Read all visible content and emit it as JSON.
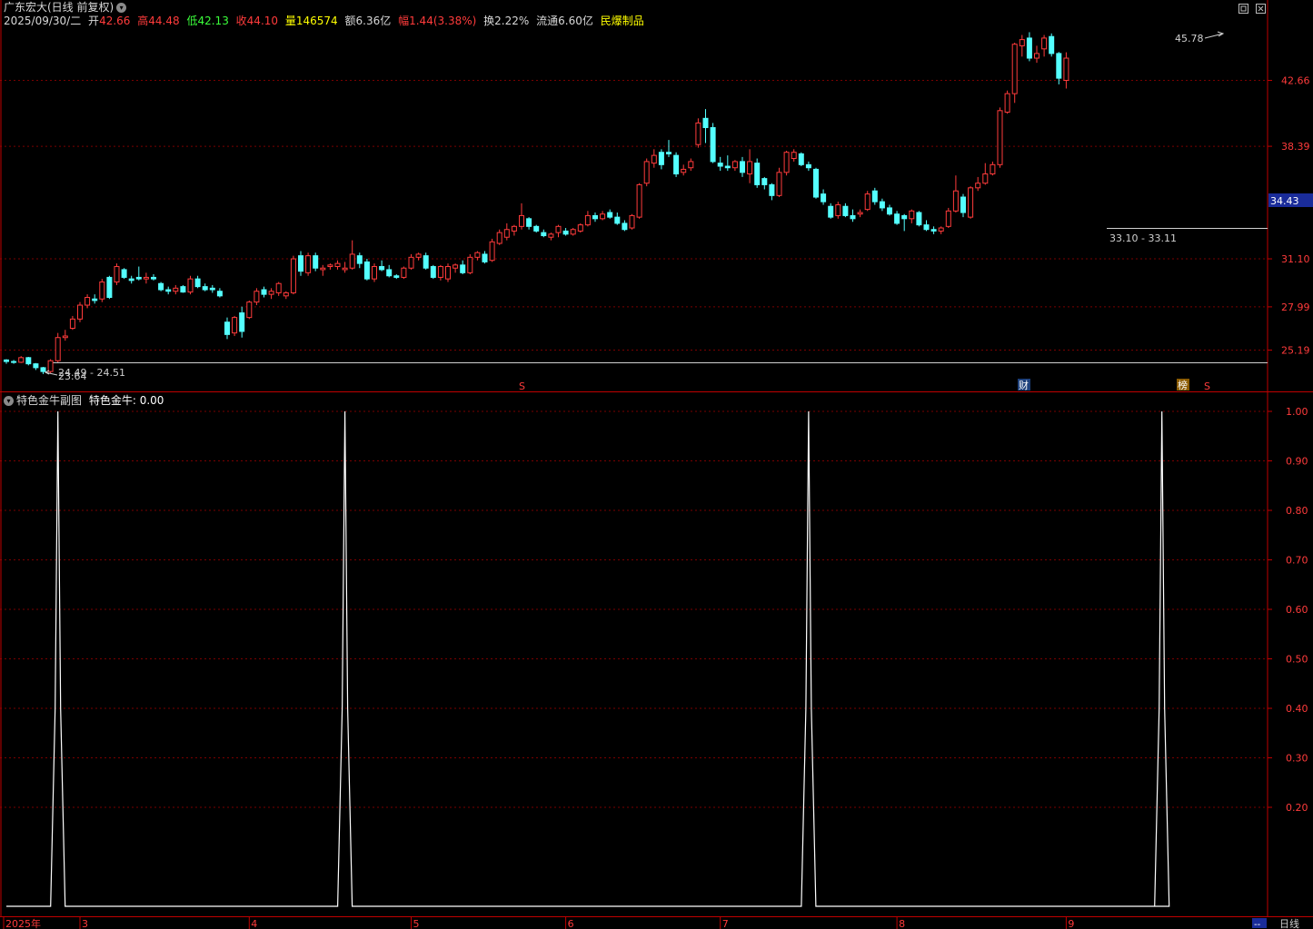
{
  "header": {
    "title": "广东宏大(日线 前复权)",
    "date": "2025/09/30/二",
    "open_label": "开",
    "open": "42.66",
    "high_label": "高",
    "high": "44.48",
    "low_label": "低",
    "low": "42.13",
    "close_label": "收",
    "close": "44.10",
    "vol_label": "量",
    "vol": "146574",
    "amount_label": "额",
    "amount": "6.36亿",
    "change_label": "幅",
    "change": "1.44(3.38%)",
    "turnover_label": "换",
    "turnover": "2.22%",
    "float_label": "流通",
    "float": "6.60亿",
    "sector": "民爆制品"
  },
  "window_controls": {
    "restore_icon": "restore-icon",
    "close_icon": "close-icon"
  },
  "sub_header": {
    "name": "特色金牛副图",
    "value_label": "特色金牛: 0.00"
  },
  "main_axis": {
    "ticks": [
      "42.66",
      "38.39",
      "31.10",
      "27.99",
      "25.19"
    ],
    "current_price": "34.43"
  },
  "sub_axis": {
    "ticks": [
      "1.00",
      "0.90",
      "0.80",
      "0.70",
      "0.60",
      "0.50",
      "0.40",
      "0.30",
      "0.20"
    ]
  },
  "annotations": {
    "high_mark": "45.78",
    "low_mark": "23.64",
    "range_left": "24.49 - 24.51",
    "range_right": "33.10 - 33.11",
    "event_s1": "S",
    "event_cai": "财",
    "event_bang": "榜",
    "event_s2": "S"
  },
  "x_axis": {
    "labels": [
      "2025年",
      "3",
      "4",
      "5",
      "6",
      "7",
      "8",
      "9"
    ]
  },
  "footer": {
    "period": "日线",
    "dash": "--"
  },
  "colors": {
    "up": "#ff3b3b",
    "down": "#54ffff",
    "grid": "#7a0000",
    "axis": "#c00000",
    "yellow": "#ffff00"
  },
  "chart_data": [
    {
      "type": "candlestick",
      "title": "广东宏大(日线 前复权)",
      "ylim": [
        23.0,
        46.5
      ],
      "y_ticks": [
        42.66,
        38.39,
        31.1,
        27.99,
        25.19
      ],
      "x_labels": [
        "2025年",
        "3",
        "4",
        "5",
        "6",
        "7",
        "8",
        "9"
      ],
      "ohlc": [
        [
          24.55,
          24.6,
          24.3,
          24.45
        ],
        [
          24.45,
          24.55,
          24.3,
          24.4
        ],
        [
          24.4,
          24.8,
          24.35,
          24.7
        ],
        [
          24.7,
          24.75,
          24.2,
          24.3
        ],
        [
          24.3,
          24.35,
          23.9,
          24.05
        ],
        [
          24.05,
          24.1,
          23.64,
          23.8
        ],
        [
          23.8,
          24.6,
          23.7,
          24.5
        ],
        [
          24.5,
          26.3,
          24.4,
          26.0
        ],
        [
          26.0,
          26.5,
          25.8,
          26.1
        ],
        [
          26.6,
          27.4,
          26.5,
          27.2
        ],
        [
          27.2,
          28.3,
          27.0,
          28.1
        ],
        [
          28.1,
          28.8,
          27.9,
          28.6
        ],
        [
          28.5,
          28.8,
          28.2,
          28.4
        ],
        [
          28.5,
          29.8,
          28.3,
          29.6
        ],
        [
          29.9,
          30.0,
          28.5,
          28.6
        ],
        [
          29.6,
          30.8,
          29.4,
          30.6
        ],
        [
          30.4,
          30.5,
          29.8,
          29.9
        ],
        [
          29.8,
          30.0,
          29.5,
          29.7
        ],
        [
          29.9,
          30.6,
          29.7,
          29.8
        ],
        [
          29.8,
          30.2,
          29.5,
          29.9
        ],
        [
          29.9,
          30.1,
          29.7,
          29.8
        ],
        [
          29.5,
          29.6,
          29.0,
          29.1
        ],
        [
          29.1,
          29.3,
          28.8,
          29.0
        ],
        [
          29.0,
          29.4,
          28.8,
          29.2
        ],
        [
          29.3,
          29.4,
          28.9,
          28.95
        ],
        [
          28.95,
          30.0,
          28.8,
          29.8
        ],
        [
          29.8,
          30.0,
          29.2,
          29.3
        ],
        [
          29.3,
          29.5,
          29.0,
          29.1
        ],
        [
          29.2,
          29.4,
          28.9,
          29.1
        ],
        [
          29.0,
          29.2,
          28.6,
          28.7
        ],
        [
          27.0,
          27.3,
          25.9,
          26.2
        ],
        [
          26.3,
          27.4,
          26.1,
          27.3
        ],
        [
          27.6,
          28.0,
          26.0,
          26.4
        ],
        [
          27.3,
          28.4,
          27.2,
          28.3
        ],
        [
          28.3,
          29.2,
          28.1,
          29.0
        ],
        [
          29.1,
          29.3,
          28.6,
          28.8
        ],
        [
          28.8,
          29.2,
          28.5,
          29.0
        ],
        [
          28.9,
          29.6,
          28.7,
          29.5
        ],
        [
          28.7,
          29.0,
          28.5,
          28.9
        ],
        [
          28.9,
          31.3,
          28.8,
          31.1
        ],
        [
          31.3,
          31.6,
          30.0,
          30.3
        ],
        [
          30.2,
          31.5,
          30.0,
          31.3
        ],
        [
          31.3,
          31.5,
          30.3,
          30.5
        ],
        [
          30.4,
          30.7,
          30.0,
          30.5
        ],
        [
          30.6,
          30.8,
          30.4,
          30.7
        ],
        [
          30.6,
          31.0,
          30.4,
          30.8
        ],
        [
          30.4,
          30.9,
          30.2,
          30.5
        ],
        [
          30.5,
          32.3,
          30.4,
          31.4
        ],
        [
          31.3,
          31.5,
          30.5,
          30.8
        ],
        [
          30.9,
          31.1,
          29.7,
          29.8
        ],
        [
          29.8,
          30.8,
          29.6,
          30.6
        ],
        [
          30.6,
          31.0,
          30.3,
          30.4
        ],
        [
          30.4,
          30.7,
          29.9,
          30.0
        ],
        [
          30.0,
          30.1,
          29.8,
          29.9
        ],
        [
          29.9,
          30.6,
          29.8,
          30.5
        ],
        [
          30.5,
          31.4,
          30.4,
          31.2
        ],
        [
          31.2,
          31.5,
          31.0,
          31.4
        ],
        [
          31.3,
          31.5,
          30.4,
          30.5
        ],
        [
          30.6,
          30.7,
          29.8,
          29.9
        ],
        [
          29.9,
          30.7,
          29.7,
          30.6
        ],
        [
          29.8,
          30.8,
          29.6,
          30.6
        ],
        [
          30.5,
          30.8,
          30.2,
          30.7
        ],
        [
          30.7,
          31.0,
          30.1,
          30.2
        ],
        [
          30.2,
          31.4,
          30.1,
          31.2
        ],
        [
          31.2,
          31.6,
          31.0,
          31.5
        ],
        [
          31.4,
          31.6,
          30.8,
          30.9
        ],
        [
          31.0,
          32.4,
          30.9,
          32.2
        ],
        [
          32.1,
          33.0,
          32.0,
          32.8
        ],
        [
          32.5,
          33.4,
          32.3,
          33.0
        ],
        [
          32.9,
          33.3,
          32.6,
          33.2
        ],
        [
          33.2,
          34.7,
          33.0,
          33.9
        ],
        [
          33.7,
          33.8,
          33.0,
          33.2
        ],
        [
          33.2,
          33.3,
          32.8,
          32.9
        ],
        [
          32.8,
          33.0,
          32.5,
          32.6
        ],
        [
          32.5,
          32.8,
          32.3,
          32.7
        ],
        [
          32.8,
          33.3,
          32.5,
          33.2
        ],
        [
          32.9,
          33.1,
          32.6,
          32.7
        ],
        [
          32.7,
          33.1,
          32.6,
          33.0
        ],
        [
          32.9,
          33.4,
          32.8,
          33.3
        ],
        [
          33.3,
          34.2,
          33.2,
          33.9
        ],
        [
          33.9,
          34.1,
          33.5,
          33.7
        ],
        [
          33.7,
          34.2,
          33.6,
          34.0
        ],
        [
          34.1,
          34.3,
          33.7,
          33.8
        ],
        [
          33.8,
          34.1,
          33.3,
          33.4
        ],
        [
          33.4,
          33.6,
          32.9,
          33.0
        ],
        [
          33.1,
          34.0,
          33.0,
          33.9
        ],
        [
          33.8,
          36.0,
          33.7,
          35.9
        ],
        [
          36.0,
          37.6,
          35.8,
          37.4
        ],
        [
          37.3,
          38.2,
          37.0,
          37.8
        ],
        [
          38.0,
          38.2,
          36.9,
          37.2
        ],
        [
          38.0,
          38.8,
          37.7,
          37.9
        ],
        [
          37.8,
          38.0,
          36.4,
          36.6
        ],
        [
          36.7,
          37.2,
          36.5,
          36.9
        ],
        [
          37.0,
          37.6,
          36.8,
          37.4
        ],
        [
          38.5,
          40.2,
          38.3,
          39.9
        ],
        [
          40.2,
          40.8,
          38.6,
          39.6
        ],
        [
          39.6,
          39.9,
          37.3,
          37.4
        ],
        [
          37.3,
          37.7,
          36.8,
          37.1
        ],
        [
          37.1,
          37.8,
          36.8,
          37.0
        ],
        [
          37.0,
          37.5,
          36.8,
          37.4
        ],
        [
          37.4,
          37.7,
          36.4,
          36.7
        ],
        [
          36.6,
          38.2,
          36.0,
          37.4
        ],
        [
          37.3,
          37.6,
          35.7,
          35.9
        ],
        [
          36.3,
          36.4,
          35.6,
          35.9
        ],
        [
          35.9,
          36.0,
          34.9,
          35.2
        ],
        [
          35.2,
          37.0,
          35.1,
          36.7
        ],
        [
          36.7,
          38.1,
          36.5,
          38.0
        ],
        [
          37.6,
          38.2,
          37.4,
          38.0
        ],
        [
          37.9,
          38.0,
          37.1,
          37.2
        ],
        [
          37.2,
          37.4,
          36.8,
          37.0
        ],
        [
          36.9,
          37.0,
          35.0,
          35.1
        ],
        [
          35.3,
          35.6,
          34.6,
          34.8
        ],
        [
          34.5,
          34.7,
          33.7,
          33.8
        ],
        [
          33.9,
          34.8,
          33.7,
          34.6
        ],
        [
          34.5,
          34.7,
          33.8,
          33.9
        ],
        [
          33.9,
          34.3,
          33.5,
          33.7
        ],
        [
          34.0,
          34.3,
          33.8,
          34.1
        ],
        [
          34.3,
          35.5,
          34.2,
          35.3
        ],
        [
          35.5,
          35.7,
          34.6,
          34.8
        ],
        [
          34.8,
          35.0,
          34.2,
          34.4
        ],
        [
          34.4,
          34.6,
          33.9,
          34.0
        ],
        [
          34.0,
          34.2,
          33.3,
          33.4
        ],
        [
          33.9,
          34.0,
          32.9,
          33.7
        ],
        [
          33.7,
          34.3,
          33.4,
          34.2
        ],
        [
          34.1,
          34.2,
          33.2,
          33.3
        ],
        [
          33.3,
          33.6,
          32.9,
          33.0
        ],
        [
          33.0,
          33.2,
          32.7,
          32.9
        ],
        [
          32.9,
          33.2,
          32.7,
          33.1
        ],
        [
          33.2,
          34.4,
          33.1,
          34.2
        ],
        [
          34.2,
          36.5,
          34.1,
          35.5
        ],
        [
          35.1,
          35.3,
          33.8,
          34.1
        ],
        [
          33.8,
          35.8,
          33.7,
          35.7
        ],
        [
          35.7,
          36.4,
          35.5,
          36.0
        ],
        [
          36.0,
          37.3,
          35.9,
          36.6
        ],
        [
          36.6,
          37.4,
          36.5,
          37.2
        ],
        [
          37.2,
          40.9,
          37.0,
          40.7
        ],
        [
          40.6,
          42.0,
          40.5,
          41.8
        ],
        [
          41.8,
          45.1,
          41.2,
          45.0
        ],
        [
          44.9,
          45.6,
          44.2,
          45.3
        ],
        [
          45.4,
          45.78,
          43.9,
          44.1
        ],
        [
          44.1,
          44.9,
          43.8,
          44.4
        ],
        [
          44.7,
          45.6,
          44.2,
          45.4
        ],
        [
          45.5,
          45.7,
          44.2,
          44.4
        ],
        [
          44.4,
          44.5,
          42.4,
          42.8
        ],
        [
          42.66,
          44.48,
          42.13,
          44.1
        ]
      ]
    },
    {
      "type": "line",
      "title": "特色金牛副图",
      "ylim": [
        0.0,
        1.0
      ],
      "y_ticks": [
        1.0,
        0.9,
        0.8,
        0.7,
        0.6,
        0.5,
        0.4,
        0.3,
        0.2
      ],
      "series": [
        {
          "name": "特色金牛",
          "spike_indices": [
            7,
            46,
            109,
            157
          ],
          "spike_value": 1.0,
          "baseline": 0.0
        }
      ]
    }
  ]
}
